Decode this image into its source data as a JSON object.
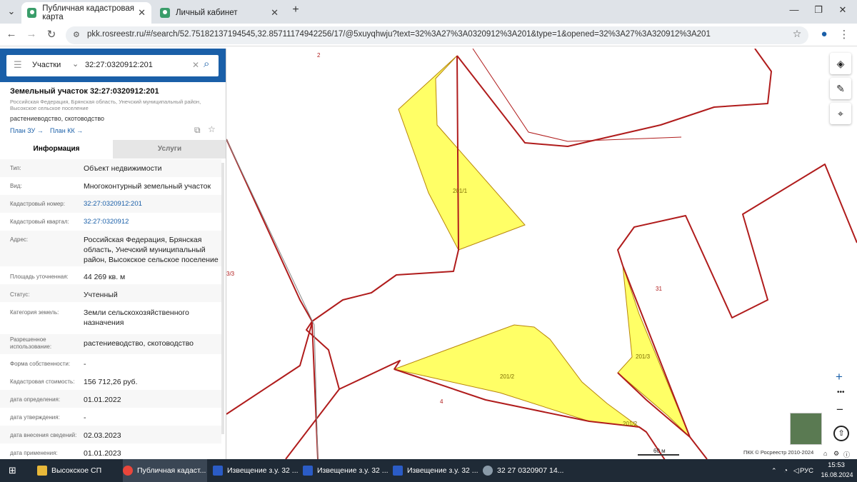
{
  "browser": {
    "tabs": [
      {
        "label": "Публичная кадастровая карта",
        "active": true
      },
      {
        "label": "Личный кабинет",
        "active": false
      }
    ],
    "url": "pkk.rosreestr.ru/#/search/52.75182137194545,32.85711174942256/17/@5xuyqhwju?text=32%3A27%3A0320912%3A201&type=1&opened=32%3A27%3A320912%3A201"
  },
  "search": {
    "type_label": "Участки",
    "query": "32:27:0320912:201"
  },
  "parcel": {
    "title": "Земельный участок 32:27:0320912:201",
    "address_short": "Российская Федерация, Брянская область, Унечский муниципальный район, Высокское сельское поселение",
    "usage": "растениеводство, скотоводство",
    "plan_zu": "План ЗУ →",
    "plan_kk": "План КК →"
  },
  "tabs": {
    "info": "Информация",
    "services": "Услуги"
  },
  "fields": [
    {
      "label": "Тип:",
      "value": "Объект недвижимости"
    },
    {
      "label": "Вид:",
      "value": "Многоконтурный земельный участок"
    },
    {
      "label": "Кадастровый номер:",
      "value": "32:27:0320912:201"
    },
    {
      "label": "Кадастровый квартал:",
      "value": "32:27:0320912"
    },
    {
      "label": "Адрес:",
      "value": "Российская Федерация, Брянская область, Унечский муниципальный район, Высокское сельское поселение"
    },
    {
      "label": "Площадь уточненная:",
      "value": "44 269 кв. м"
    },
    {
      "label": "Статус:",
      "value": "Учтенный"
    },
    {
      "label": "Категория земель:",
      "value": "Земли сельскохозяйственного назначения"
    },
    {
      "label": "Разрешенное использование:",
      "value": "растениеводство, скотоводство"
    },
    {
      "label": "Форма собственности:",
      "value": "-"
    },
    {
      "label": "Кадастровая стоимость:",
      "value": "156 712,26 руб."
    },
    {
      "label": "дата определения:",
      "value": "01.01.2022"
    },
    {
      "label": "дата утверждения:",
      "value": "-"
    },
    {
      "label": "дата внесения сведений:",
      "value": "02.03.2023"
    },
    {
      "label": "дата применения:",
      "value": "01.01.2023"
    }
  ],
  "map": {
    "labels": {
      "l2": "2",
      "l201_1": "201/1",
      "l201_2": "201/2",
      "l201_2b": "201/2",
      "l201_3": "201/3",
      "l31": "31",
      "l4": "4",
      "l3_3": "3/3"
    },
    "scale": "60 м",
    "copyright": "ПКК © Росреестр 2010-2024"
  },
  "taskbar": {
    "items": [
      "Высокское СП",
      "Публичная кадаст...",
      "Извещение з.у. 32 ...",
      "Извещение з.у. 32 ...",
      "Извещение з.у. 32 ...",
      "32  27  0320907  14..."
    ],
    "lang": "РУС",
    "time": "15:53",
    "date": "16.08.2024"
  },
  "colors": {
    "accent": "#1a5fa8",
    "parcel_fill": "#ffff66",
    "boundary": "#b01c1c"
  }
}
